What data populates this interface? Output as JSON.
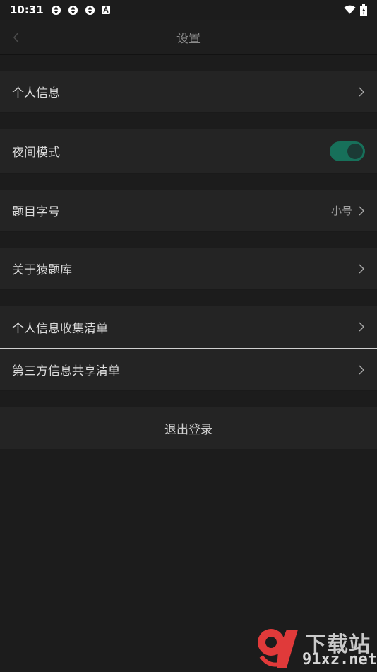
{
  "status_bar": {
    "time": "10:31",
    "icons": [
      "sync-icon",
      "sync-icon",
      "sync-icon",
      "a-icon"
    ],
    "right_icons": [
      "wifi-icon",
      "battery-icon"
    ]
  },
  "nav": {
    "title": "设置",
    "back_icon": "chevron-left-icon"
  },
  "settings": {
    "personal_info": "个人信息",
    "night_mode": "夜间模式",
    "night_mode_on": true,
    "font_size_label": "题目字号",
    "font_size_value": "小号",
    "about": "关于猿题库",
    "personal_info_list": "个人信息收集清单",
    "third_party_list": "第三方信息共享清单",
    "logout": "退出登录"
  },
  "watermark": {
    "brand": "下载站",
    "site": "91xz.net"
  },
  "colors": {
    "background": "#1c1c1c",
    "row": "#242424",
    "toggle_on": "#17705a",
    "watermark_red": "#e03a3a"
  }
}
